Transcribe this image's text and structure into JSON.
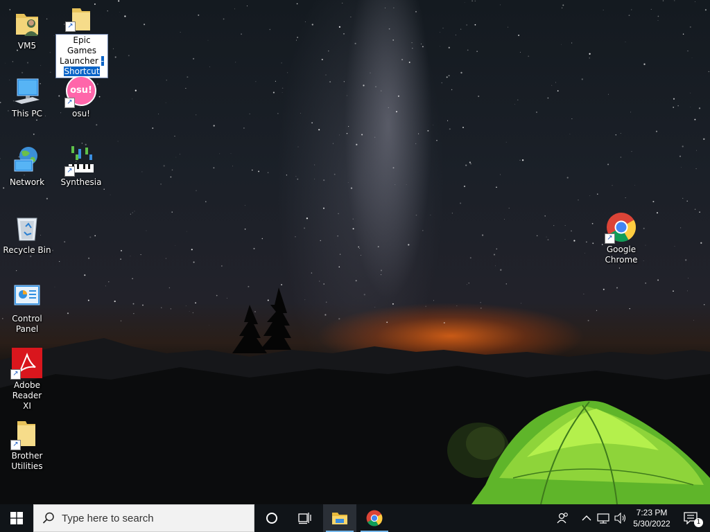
{
  "desktop": {
    "icons": [
      {
        "label": "VM5"
      },
      {
        "label_line1": "Epic Games",
        "label_line2": "Launcher",
        "label_line2_sel": "-",
        "label_line3": "Shortcut"
      },
      {
        "label": "This PC"
      },
      {
        "label": "osu!",
        "badge_text": "osu!"
      },
      {
        "label": "Network"
      },
      {
        "label": "Synthesia"
      },
      {
        "label": "Recycle Bin"
      },
      {
        "label": "Control Panel"
      },
      {
        "label_line1": "Adobe Reader",
        "label_line2": "XI"
      },
      {
        "label_line1": "Brother",
        "label_line2": "Utilities"
      },
      {
        "label_line1": "Google",
        "label_line2": "Chrome"
      }
    ]
  },
  "taskbar": {
    "start_icon": "windows-logo-icon",
    "search_placeholder": "Type here to search",
    "cortana_icon": "cortana-circle-icon",
    "taskview_icon": "task-view-icon",
    "pinned": [
      "file-explorer",
      "google-chrome"
    ],
    "tray_icons": [
      "people-icon",
      "chevron-up-icon",
      "network-icon",
      "volume-icon"
    ],
    "time": "7:23 PM",
    "date": "5/30/2022",
    "notification_count": "1",
    "accent_color": "#76b9ed"
  }
}
